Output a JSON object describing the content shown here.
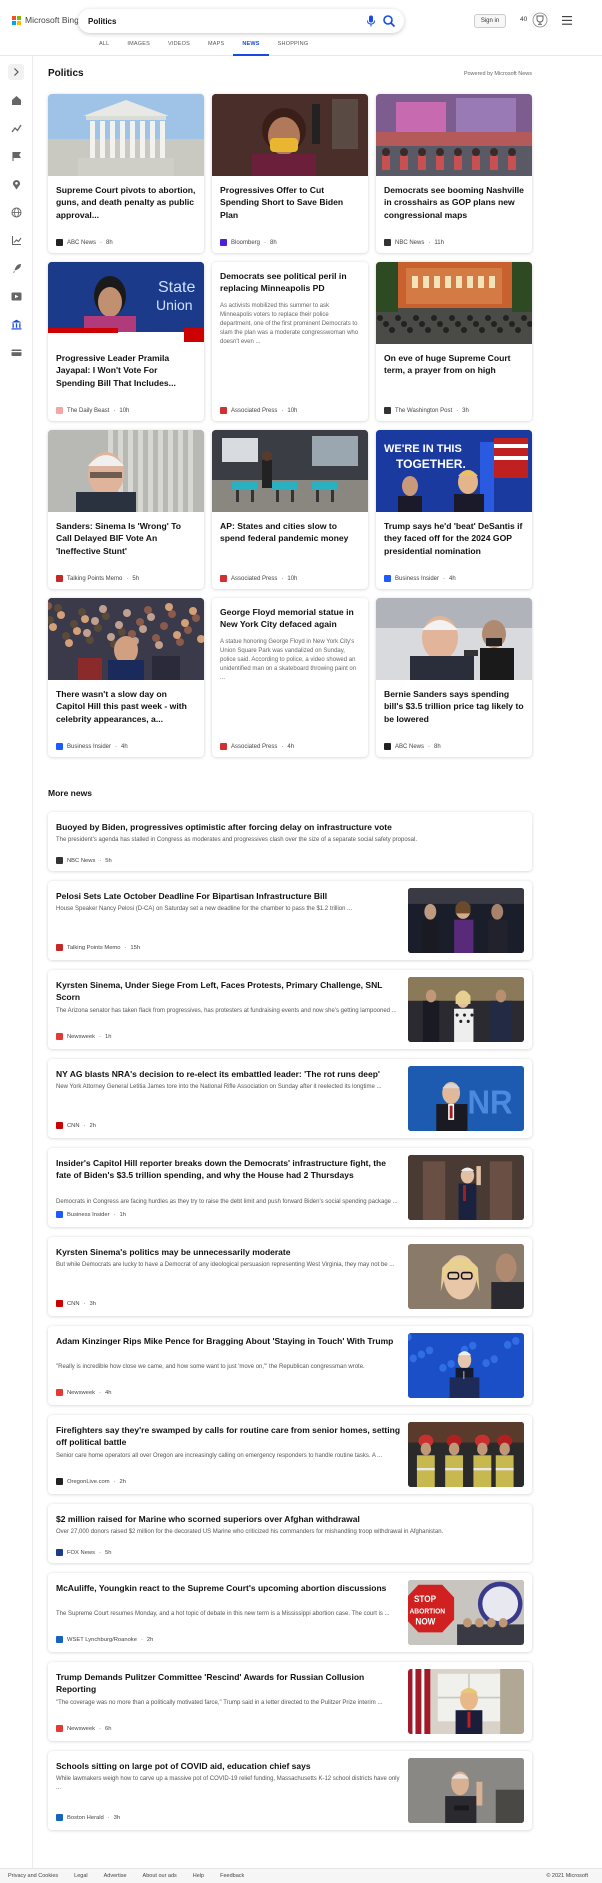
{
  "brand": {
    "name": "Microsoft Bing"
  },
  "search": {
    "value": "Politics"
  },
  "header": {
    "sign_in": "Sign in",
    "points": "40"
  },
  "tabs": [
    {
      "label": "ALL"
    },
    {
      "label": "IMAGES"
    },
    {
      "label": "VIDEOS"
    },
    {
      "label": "MAPS"
    },
    {
      "label": "NEWS"
    },
    {
      "label": "SHOPPING"
    }
  ],
  "section": {
    "title": "Politics",
    "powered": "Powered by Microsoft News"
  },
  "cards": [
    {
      "title": "Supreme Court pivots to abortion, guns, and death penalty as public approval...",
      "source": "ABC News",
      "time": "8h",
      "src_color": "#222222",
      "image": "supreme-court-building"
    },
    {
      "title": "Progressives Offer to Cut Spending Short to Save Biden Plan",
      "source": "Bloomberg",
      "time": "8h",
      "src_color": "#4a21d6",
      "image": "woman-with-mask"
    },
    {
      "title": "Democrats see booming Nashville in crosshairs as GOP plans new congressional maps",
      "source": "NBC News",
      "time": "11h",
      "src_color": "#333333",
      "image": "nashville-street"
    },
    {
      "title": "Progressive Leader Pramila Jayapal: I Won't Vote For Spending Bill That Includes...",
      "source": "The Daily Beast",
      "time": "10h",
      "src_color": "#f6a5a5",
      "image": "cnn-broadcast"
    },
    {
      "title": "Democrats see political peril in replacing Minneapolis PD",
      "summary": "As activists mobilized this summer to ask Minneapolis voters to replace their police department, one of the first prominent Democrats to slam the plan was a moderate congresswoman who doesn't even ...",
      "source": "Associated Press",
      "time": "10h",
      "src_color": "#d32f2f"
    },
    {
      "title": "On eve of huge Supreme Court term, a prayer from on high",
      "source": "The Washington Post",
      "time": "3h",
      "src_color": "#333333",
      "image": "crowd-at-building"
    },
    {
      "title": "Sanders: Sinema Is 'Wrong' To Call Delayed BIF Vote An 'Ineffective Stunt'",
      "source": "Talking Points Memo",
      "time": "5h",
      "src_color": "#c62828",
      "image": "bernie-sanders"
    },
    {
      "title": "AP: States and cities slow to spend federal pandemic money",
      "source": "Associated Press",
      "time": "10h",
      "src_color": "#d32f2f",
      "image": "classroom"
    },
    {
      "title": "Trump says he'd 'beat' DeSantis if they faced off for the 2024 GOP presidential nomination",
      "source": "Business Insider",
      "time": "4h",
      "src_color": "#1e5bff",
      "image": "rally-stage",
      "image_text": "WE'RE IN THIS TOGETHER."
    },
    {
      "title": "There wasn't a slow day on Capitol Hill this past week - with celebrity appearances, a...",
      "source": "Business Insider",
      "time": "4h",
      "src_color": "#1e5bff",
      "image": "baseball-crowd"
    },
    {
      "title": "George Floyd memorial statue in New York City defaced again",
      "summary": "A statue honoring George Floyd in New York City's Union Square Park was vandalized on Sunday, police said. According to police, a video showed an unidentified man on a skateboard throwing paint on ...",
      "source": "Associated Press",
      "time": "4h",
      "src_color": "#d32f2f"
    },
    {
      "title": "Bernie Sanders says spending bill's $3.5 trillion price tag likely to be lowered",
      "source": "ABC News",
      "time": "8h",
      "src_color": "#222222",
      "image": "bernie-press"
    }
  ],
  "more_news": {
    "title": "More news",
    "items": [
      {
        "title": "Buoyed by Biden, progressives optimistic after forcing delay on infrastructure vote",
        "summary": "The president's agenda has stalled in Congress as moderates and progressives clash over the size of a separate social safety proposal.",
        "source": "NBC News",
        "time": "5h",
        "src_color": "#333333"
      },
      {
        "title": "Pelosi Sets Late October Deadline For Bipartisan Infrastructure Bill",
        "summary": "House Speaker Nancy Pelosi (D-CA) on Saturday set a new deadline for the chamber to pass the $1.2 trillion ...",
        "source": "Talking Points Memo",
        "time": "15h",
        "src_color": "#c62828",
        "image": "pelosi-hallway"
      },
      {
        "title": "Kyrsten Sinema, Under Siege From Left, Faces Protests, Primary Challenge, SNL Scorn",
        "summary": "The Arizona senator has taken flack from progressives, has protesters at fundraising events and now she's getting lampooned ...",
        "source": "Newsweek",
        "time": "1h",
        "src_color": "#e53935",
        "image": "sinema-walking"
      },
      {
        "title": "NY AG blasts NRA's decision to re-elect its embattled leader: 'The rot runs deep'",
        "summary": "New York Attorney General Letitia James tore into the National Rifle Association on Sunday after it reelected its longtime ...",
        "source": "CNN",
        "time": "2h",
        "src_color": "#cc0000",
        "image": "nra-speaker"
      },
      {
        "title": "Insider's Capitol Hill reporter breaks down the Democrats' infrastructure fight, the fate of Biden's $3.5 trillion spending, and why the House had 2 Thursdays",
        "summary": "Democrats in Congress are facing hurdles as they try to raise the debt limit and push forward Biden's social spending package ...",
        "source": "Business Insider",
        "time": "1h",
        "src_color": "#1e5bff",
        "image": "biden-waving"
      },
      {
        "title": "Kyrsten Sinema's politics may be unnecessarily moderate",
        "summary": "But while Democrats are lucky to have a Democrat of any ideological persuasion representing West Virginia, they may not be ...",
        "source": "CNN",
        "time": "3h",
        "src_color": "#cc0000",
        "image": "sinema-portrait"
      },
      {
        "title": "Adam Kinzinger Rips Mike Pence for Bragging About 'Staying in Touch' With Trump",
        "summary": "\"Really is incredible how close we came, and how some want to just 'move on,'\" the Republican congressman wrote.",
        "source": "Newsweek",
        "time": "4h",
        "src_color": "#e53935",
        "image": "pence-podium"
      },
      {
        "title": "Firefighters say they're swamped by calls for routine care from senior homes, setting off political battle",
        "summary": "Senior care home operators all over Oregon are increasingly calling on emergency responders to handle routine tasks. A ...",
        "source": "OregonLive.com",
        "time": "2h",
        "src_color": "#222222",
        "image": "firefighters"
      },
      {
        "title": "$2 million raised for Marine who scorned superiors over Afghan withdrawal",
        "summary": "Over 27,000 donors raised $2 million for the decorated US Marine who criticized his commanders for mishandling troop withdrawal in Afghanistan.",
        "source": "FOX News",
        "time": "5h",
        "src_color": "#1a3a8a"
      },
      {
        "title": "McAuliffe, Youngkin react to the Supreme Court's upcoming abortion discussions",
        "summary": "The Supreme Court resumes Monday, and a hot topic of debate in this new term is a Mississippi abortion case. The court is ...",
        "source": "WSET Lynchburg/Roanoke",
        "time": "2h",
        "src_color": "#1565c0",
        "image": "abortion-signs",
        "image_text": "STOP ABORTION NOW"
      },
      {
        "title": "Trump Demands Pulitzer Committee 'Rescind' Awards for Russian Collusion Reporting",
        "summary": "\"The coverage was no more than a politically motivated farce,\" Trump said in a letter directed to the Pulitzer Prize interim ...",
        "source": "Newsweek",
        "time": "6h",
        "src_color": "#e53935",
        "image": "trump-window"
      },
      {
        "title": "Schools sitting on large pot of COVID aid, education chief says",
        "summary": "While lawmakers weigh how to carve up a massive pot of COVID-19 relief funding, Massachusetts K-12 school districts have only ...",
        "source": "Boston Herald",
        "time": "3h",
        "src_color": "#1565c0",
        "image": "man-at-podium"
      }
    ]
  },
  "footer": {
    "links": [
      "Privacy and Cookies",
      "Legal",
      "Advertise",
      "About our ads",
      "Help",
      "Feedback"
    ],
    "copyright": "© 2021 Microsoft"
  }
}
